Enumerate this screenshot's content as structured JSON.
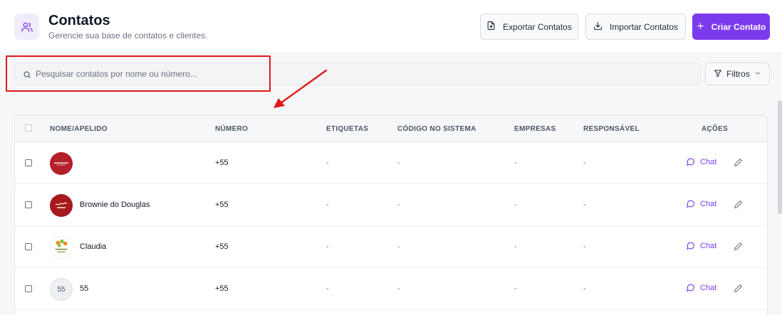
{
  "header": {
    "title": "Contatos",
    "subtitle": "Gerencie sua base de contatos e clientes.",
    "page_icon": "users-icon",
    "export_label": "Exportar Contatos",
    "import_label": "Importar Contatos",
    "create_label": "Criar Contato"
  },
  "search": {
    "placeholder": "Pesquisar contatos por nome ou número...",
    "value": ""
  },
  "filters": {
    "label": "Filtros"
  },
  "table": {
    "columns": [
      "NOME/APELIDO",
      "NÚMERO",
      "ETIQUETAS",
      "CÓDIGO NO SISTEMA",
      "EMPRESAS",
      "RESPONSÁVEL",
      "AÇÕES"
    ],
    "rows": [
      {
        "avatar": "red-brand-logo",
        "avatar_text": "",
        "name": "",
        "number": "+55",
        "tags": "-",
        "code": "-",
        "companies": "-",
        "owner": "-",
        "chat": "Chat"
      },
      {
        "avatar": "brownie-logo",
        "avatar_text": "",
        "name": "Brownie do Douglas",
        "number": "+55",
        "tags": "-",
        "code": "-",
        "companies": "-",
        "owner": "-",
        "chat": "Chat"
      },
      {
        "avatar": "floral-logo",
        "avatar_text": "",
        "name": "Claudia",
        "number": "+55",
        "tags": "-",
        "code": "-",
        "companies": "-",
        "owner": "-",
        "chat": "Chat"
      },
      {
        "avatar": "initials",
        "avatar_text": "55",
        "name": "55",
        "number": "+55",
        "tags": "-",
        "code": "-",
        "companies": "-",
        "owner": "-",
        "chat": "Chat"
      }
    ]
  },
  "colors": {
    "accent": "#7c3aed",
    "annotation": "#e0191c",
    "background": "#f6f7f9"
  }
}
